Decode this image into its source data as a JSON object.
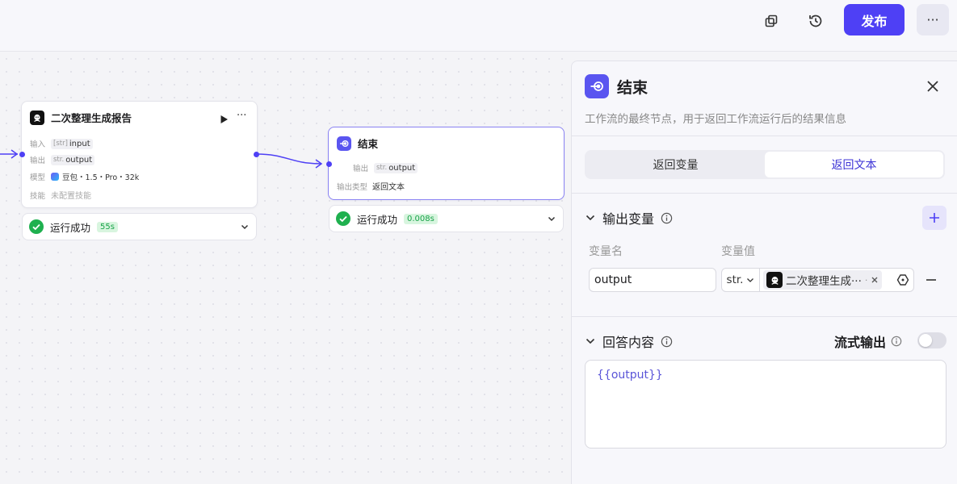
{
  "toolbar": {
    "publish_label": "发布",
    "more_label": "···"
  },
  "nodes": {
    "llm": {
      "title": "二次整理生成报告",
      "input_label": "输入",
      "input_value": "input",
      "input_type": "[str]",
      "output_label": "输出",
      "output_type": "str.",
      "output_value": "output",
      "model_label": "模型",
      "model_value": "豆包・1.5・Pro・32k",
      "skill_label": "技能",
      "skill_value": "未配置技能",
      "status_text": "运行成功",
      "status_time": "55s"
    },
    "end": {
      "title": "结束",
      "output_label": "输出",
      "output_type": "str.",
      "output_value": "output",
      "output_type_label": "输出类型",
      "output_type_value": "返回文本",
      "status_text": "运行成功",
      "status_time": "0.008s"
    }
  },
  "panel": {
    "title": "结束",
    "description": "工作流的最终节点，用于返回工作流运行后的结果信息",
    "tabs": [
      {
        "label": "返回变量",
        "active": false
      },
      {
        "label": "返回文本",
        "active": true
      }
    ],
    "output_section": {
      "title": "输出变量",
      "col_name": "变量名",
      "col_value": "变量值",
      "var_name": "output",
      "var_type": "str.",
      "ref_label": "二次整理生成···",
      "ref_dot": "·"
    },
    "answer_section": {
      "title": "回答内容",
      "stream_label": "流式输出",
      "stream_enabled": false,
      "content": "{{output}}"
    }
  },
  "colors": {
    "accent": "#4e40f5",
    "success": "#1aa34a"
  }
}
